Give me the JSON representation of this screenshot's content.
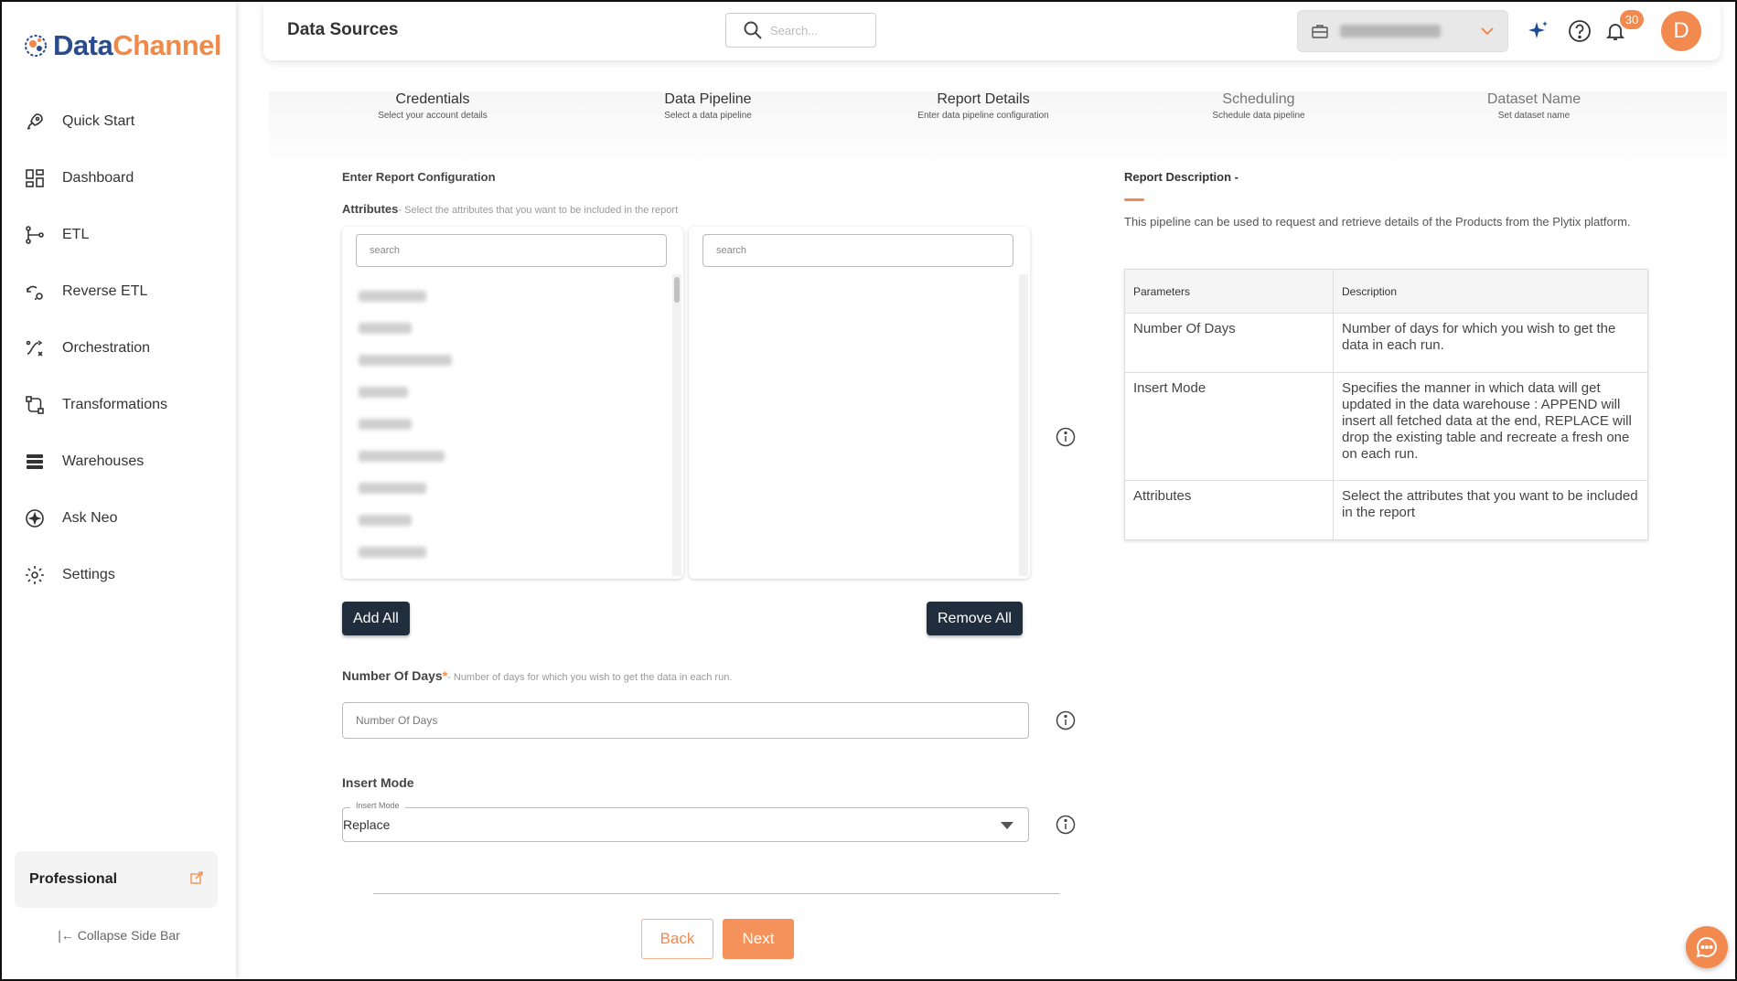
{
  "sidebar": {
    "logo": {
      "part1": "Data",
      "part2": "Channel"
    },
    "items": [
      {
        "label": "Quick Start",
        "icon": "rocket-icon"
      },
      {
        "label": "Dashboard",
        "icon": "dashboard-icon"
      },
      {
        "label": "ETL",
        "icon": "etl-icon"
      },
      {
        "label": "Reverse ETL",
        "icon": "reverse-etl-icon"
      },
      {
        "label": "Orchestration",
        "icon": "orchestration-icon"
      },
      {
        "label": "Transformations",
        "icon": "transformations-icon"
      },
      {
        "label": "Warehouses",
        "icon": "warehouses-icon"
      },
      {
        "label": "Ask Neo",
        "icon": "ask-neo-icon"
      },
      {
        "label": "Settings",
        "icon": "gear-icon"
      }
    ],
    "plan": "Professional",
    "collapse_label": "|← Collapse Side Bar"
  },
  "header": {
    "title": "Data Sources",
    "search_placeholder": "Search...",
    "notification_count": "30",
    "avatar_initial": "D"
  },
  "steps": [
    {
      "title": "Credentials",
      "subtitle": "Select your account details",
      "state": "done"
    },
    {
      "title": "Data Pipeline",
      "subtitle": "Select a data pipeline",
      "state": "done"
    },
    {
      "title": "Report Details",
      "subtitle": "Enter data pipeline configuration",
      "state": "current"
    },
    {
      "title": "Scheduling",
      "subtitle": "Schedule data pipeline",
      "state": "todo"
    },
    {
      "title": "Dataset Name",
      "subtitle": "Set dataset name",
      "state": "todo"
    }
  ],
  "form": {
    "section_title": "Enter Report Configuration",
    "attributes_label": "Attributes",
    "attributes_hint": "- Select the attributes that you want to be included in the report",
    "left_search_placeholder": "search",
    "right_search_placeholder": "search",
    "add_all": "Add All",
    "remove_all": "Remove All",
    "days_label": "Number Of Days",
    "days_required": "*",
    "days_hint": "- Number of days for which you wish to get the data in each run.",
    "days_placeholder": "Number Of Days",
    "insert_mode_label": "Insert Mode",
    "insert_mode_legend": "Insert Mode",
    "insert_mode_value": "Replace",
    "back": "Back",
    "next": "Next"
  },
  "description": {
    "title": "Report Description -",
    "text": "This pipeline can be used to request and retrieve details of the Products from the Plytix platform.",
    "table_headers": [
      "Parameters",
      "Description"
    ],
    "rows": [
      {
        "param": "Number Of Days",
        "desc": "Number of days for which you wish to get the data in each run."
      },
      {
        "param": "Insert Mode",
        "desc": "Specifies the manner in which data will get updated in the data warehouse : APPEND will insert all fetched data at the end, REPLACE will drop the existing table and recreate a fresh one on each run."
      },
      {
        "param": "Attributes",
        "desc": "Select the attributes that you want to be included in the report"
      }
    ]
  },
  "colors": {
    "accent": "#f28a4f",
    "brand_blue": "#2a4b8d",
    "dark_button": "#1f2d3d"
  }
}
